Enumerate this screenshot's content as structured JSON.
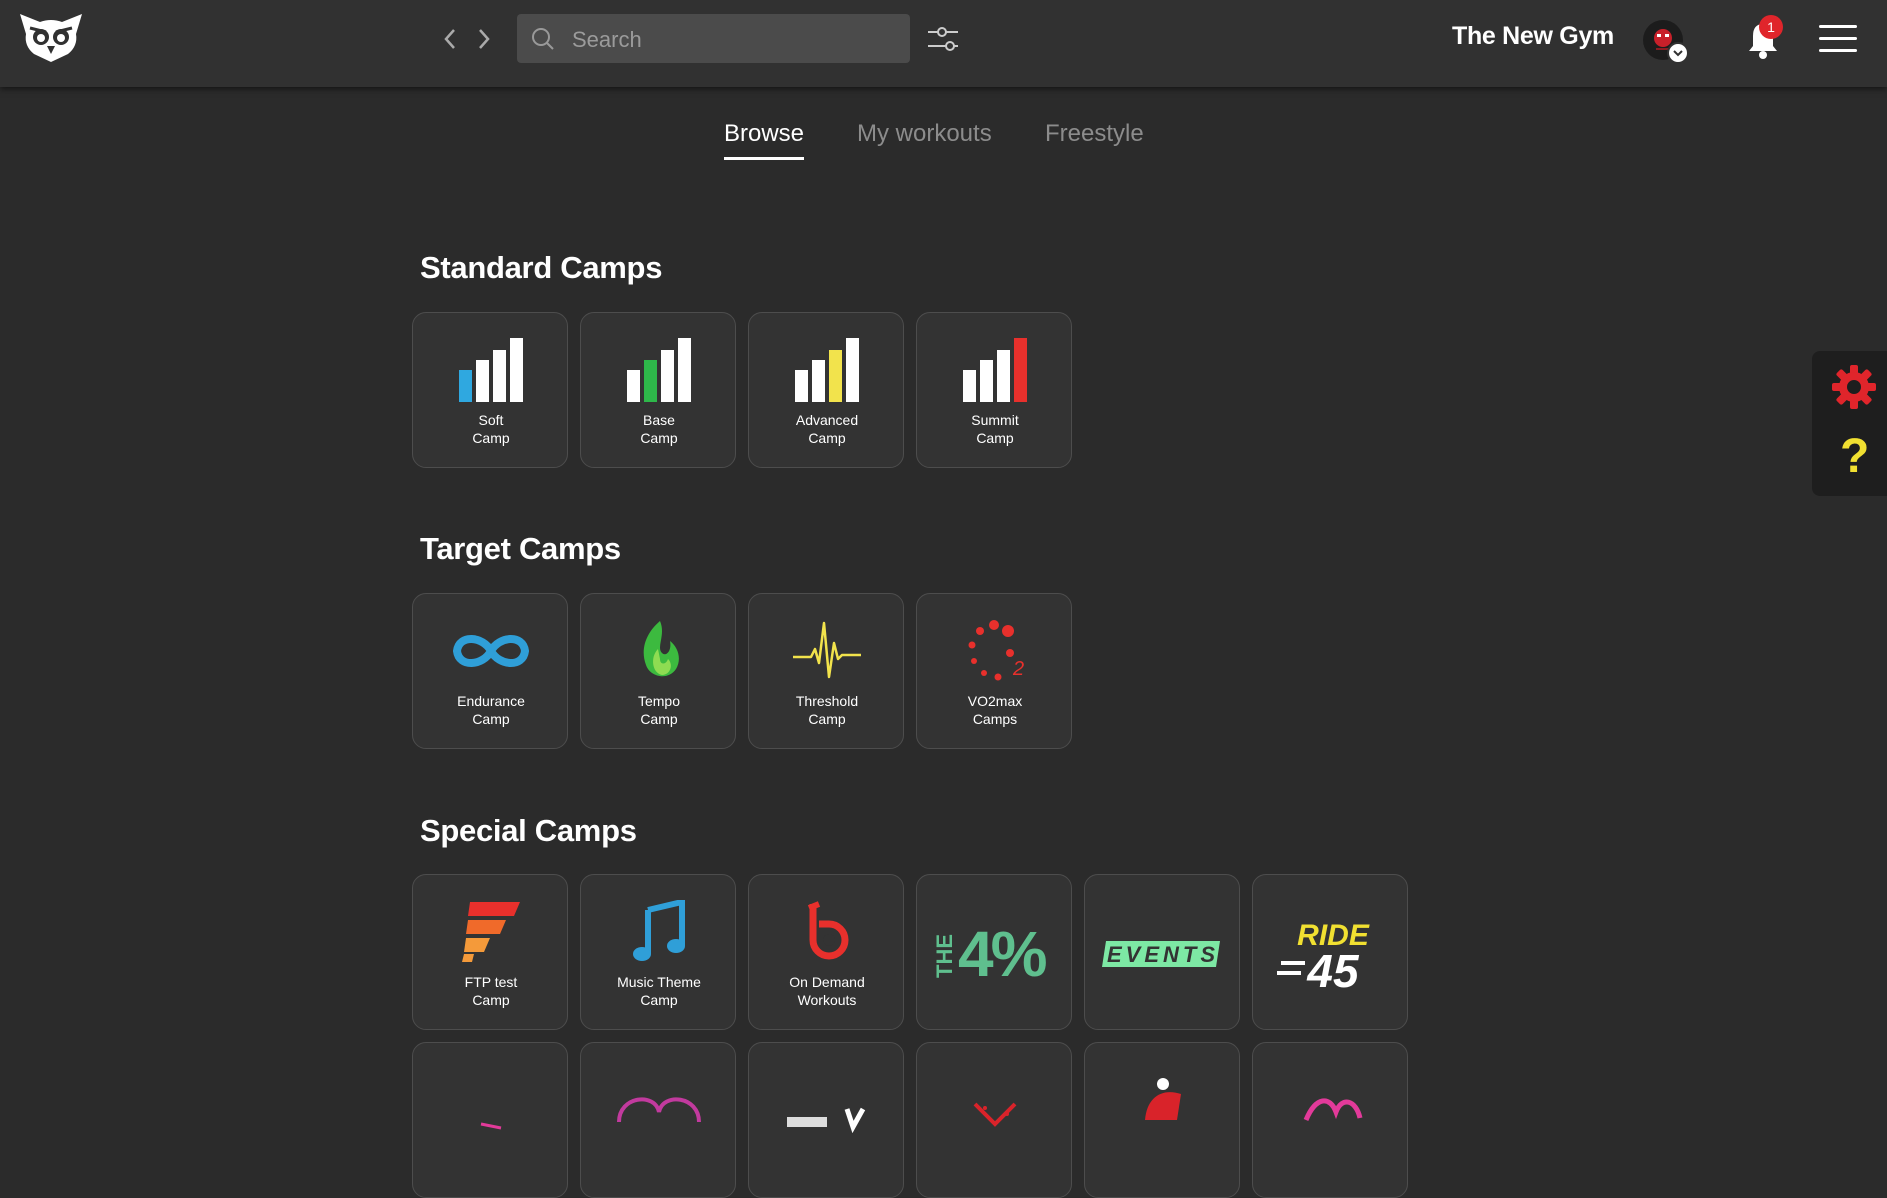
{
  "header": {
    "search_placeholder": "Search",
    "gym_name": "The New Gym",
    "notification_count": "1"
  },
  "tabs": [
    {
      "label": "Browse",
      "active": true
    },
    {
      "label": "My workouts",
      "active": false
    },
    {
      "label": "Freestyle",
      "active": false
    }
  ],
  "sections": {
    "standard": {
      "title": "Standard Camps",
      "cards": [
        {
          "line1": "Soft",
          "line2": "Camp",
          "color": "#2fa8e0"
        },
        {
          "line1": "Base",
          "line2": "Camp",
          "color": "#2eb84a"
        },
        {
          "line1": "Advanced",
          "line2": "Camp",
          "color": "#f2e34c"
        },
        {
          "line1": "Summit",
          "line2": "Camp",
          "color": "#e8302c"
        }
      ]
    },
    "target": {
      "title": "Target Camps",
      "cards": [
        {
          "line1": "Endurance",
          "line2": "Camp",
          "icon": "infinity-icon"
        },
        {
          "line1": "Tempo",
          "line2": "Camp",
          "icon": "flame-icon"
        },
        {
          "line1": "Threshold",
          "line2": "Camp",
          "icon": "heartbeat-icon"
        },
        {
          "line1": "VO2max",
          "line2": "Camps",
          "icon": "vo2-dots-icon"
        }
      ]
    },
    "special": {
      "title": "Special Camps",
      "cards": [
        {
          "line1": "FTP test",
          "line2": "Camp",
          "icon": "ftp-icon"
        },
        {
          "line1": "Music Theme",
          "line2": "Camp",
          "icon": "music-note-icon"
        },
        {
          "line1": "On Demand",
          "line2": "Workouts",
          "icon": "on-demand-icon"
        },
        {
          "logo_text": "THE 4%",
          "icon": "the-4-percent-logo"
        },
        {
          "logo_text": "EVENTS",
          "icon": "events-logo"
        },
        {
          "logo_text": "RIDE 45",
          "icon": "ride-45-logo"
        }
      ]
    }
  },
  "colors": {
    "background": "#2b2b2b",
    "topbar": "#313131",
    "card": "#333333",
    "accent_red": "#e0252b",
    "accent_yellow": "#f1e031"
  }
}
